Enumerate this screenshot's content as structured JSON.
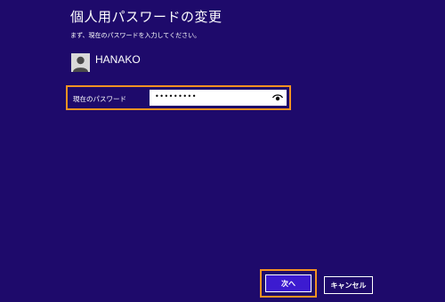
{
  "dialog": {
    "title": "個人用パスワードの変更",
    "instruction": "まず、現在のパスワードを入力してください。"
  },
  "user": {
    "name": "HANAKO"
  },
  "password_field": {
    "label": "現在のパスワード",
    "masked_value": "•••••••••"
  },
  "buttons": {
    "next_label": "次へ",
    "cancel_label": "キャンセル"
  },
  "colors": {
    "background": "#1e0a6b",
    "highlight": "#f39222",
    "primary_button": "#3c1bd0"
  },
  "icons": {
    "avatar": "user-avatar-icon",
    "reveal": "eye-icon"
  }
}
